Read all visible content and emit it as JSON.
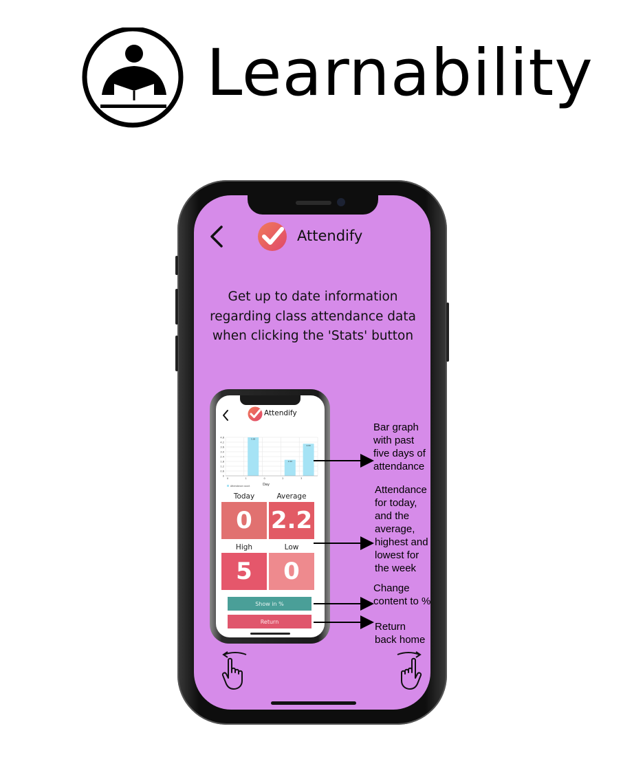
{
  "brand": {
    "title": "Learnability",
    "logo_icon": "reading-person-icon"
  },
  "app": {
    "name": "Attendify",
    "logo_icon": "checkmark-badge-icon",
    "back_icon": "chevron-left-icon"
  },
  "description": "Get up to date information regarding class attendance data when clicking the 'Stats' button",
  "inner_app": {
    "name": "Attendify",
    "chart_data": {
      "type": "bar",
      "categories": [
        "0",
        "1",
        "0",
        "2",
        "3"
      ],
      "series": [
        {
          "name": "Attendance count",
          "values": [
            0,
            5,
            0,
            2,
            4
          ]
        }
      ],
      "bar_labels": [
        "",
        "5.00",
        "",
        "2.00",
        "4.00"
      ],
      "xlabel": "Day",
      "ylabel": "",
      "ylim": [
        0,
        4.8
      ],
      "y_ticks": [
        "4.8",
        "4.2",
        "3.6",
        "3.0",
        "2.4",
        "1.8",
        "1.2",
        "0.6",
        "0"
      ],
      "grid": true,
      "legend": "bottom-left",
      "bar_color": "#a6e3f5"
    },
    "stats": {
      "today": {
        "label": "Today",
        "value": "0"
      },
      "average": {
        "label": "Average",
        "value": "2.2"
      },
      "high": {
        "label": "High",
        "value": "5"
      },
      "low": {
        "label": "Low",
        "value": "0"
      }
    },
    "buttons": {
      "percent": "Show in %",
      "return": "Return"
    }
  },
  "annotations": {
    "bar_graph": [
      "Bar graph",
      "with past",
      "five days of",
      "attendance"
    ],
    "stats_info": [
      "Attendance",
      "for today,",
      "and the",
      "average,",
      "highest and",
      "lowest for",
      "the week"
    ],
    "change": [
      "Change",
      "content to %"
    ],
    "return": [
      "Return",
      "back home"
    ]
  },
  "gestures": {
    "left": "swipe-left-hand-icon",
    "right": "swipe-right-hand-icon"
  },
  "colors": {
    "screen_bg": "#d68be9",
    "stat_today": "#e17170",
    "stat_average": "#e25b65",
    "stat_high": "#e5576b",
    "stat_low": "#ee8a8e",
    "button_percent": "#4a9f98",
    "button_return": "#e0566c"
  }
}
